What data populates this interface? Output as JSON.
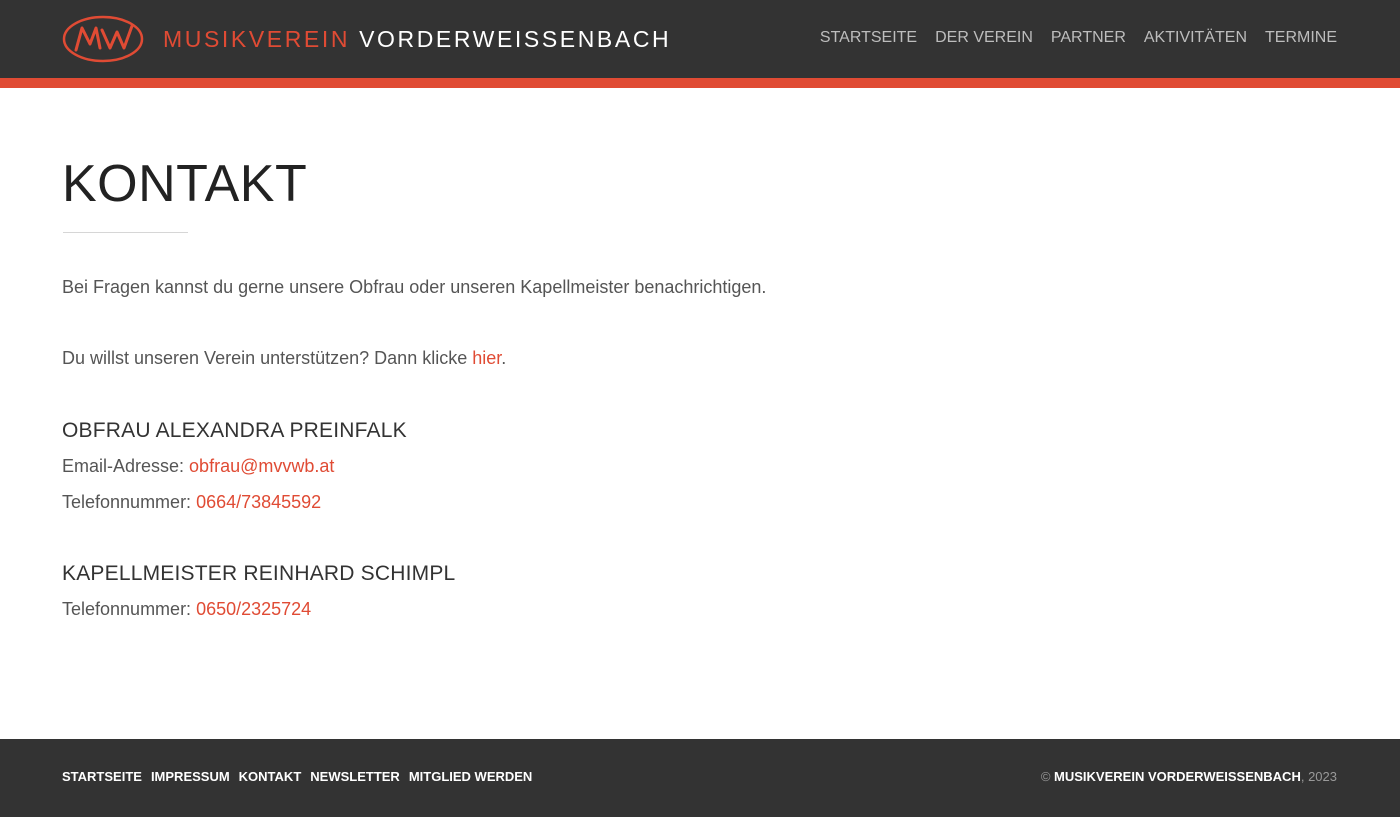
{
  "header": {
    "brand_part1": "MUSIKVEREIN",
    "brand_part2": "VORDERWEISSENBACH",
    "nav": [
      "STARTSEITE",
      "DER VEREIN",
      "PARTNER",
      "AKTIVITÄTEN",
      "TERMINE"
    ]
  },
  "main": {
    "title": "KONTAKT",
    "intro": "Bei Fragen kannst du gerne unsere Obfrau oder unseren Kapellmeister benachrichtigen.",
    "support_text": "Du willst unseren Verein unterstützen? Dann klicke ",
    "support_link": "hier",
    "support_end": ".",
    "contacts": [
      {
        "heading": "OBFRAU ALEXANDRA PREINFALK",
        "email_label": "Email-Adresse: ",
        "email": "obfrau@mvvwb.at",
        "phone_label": "Telefonnummer: ",
        "phone": "0664/73845592"
      },
      {
        "heading": "KAPELLMEISTER REINHARD SCHIMPL",
        "phone_label": "Telefonnummer: ",
        "phone": "0650/2325724"
      }
    ]
  },
  "footer": {
    "links": [
      "STARTSEITE",
      "IMPRESSUM",
      "KONTAKT",
      "NEWSLETTER",
      "MITGLIED WERDEN"
    ],
    "copyright_symbol": "© ",
    "copyright_org": "MUSIKVEREIN VORDERWEISSENBACH",
    "copyright_year": ", 2023"
  },
  "colors": {
    "accent": "#e04b34",
    "header_bg": "#333333"
  }
}
